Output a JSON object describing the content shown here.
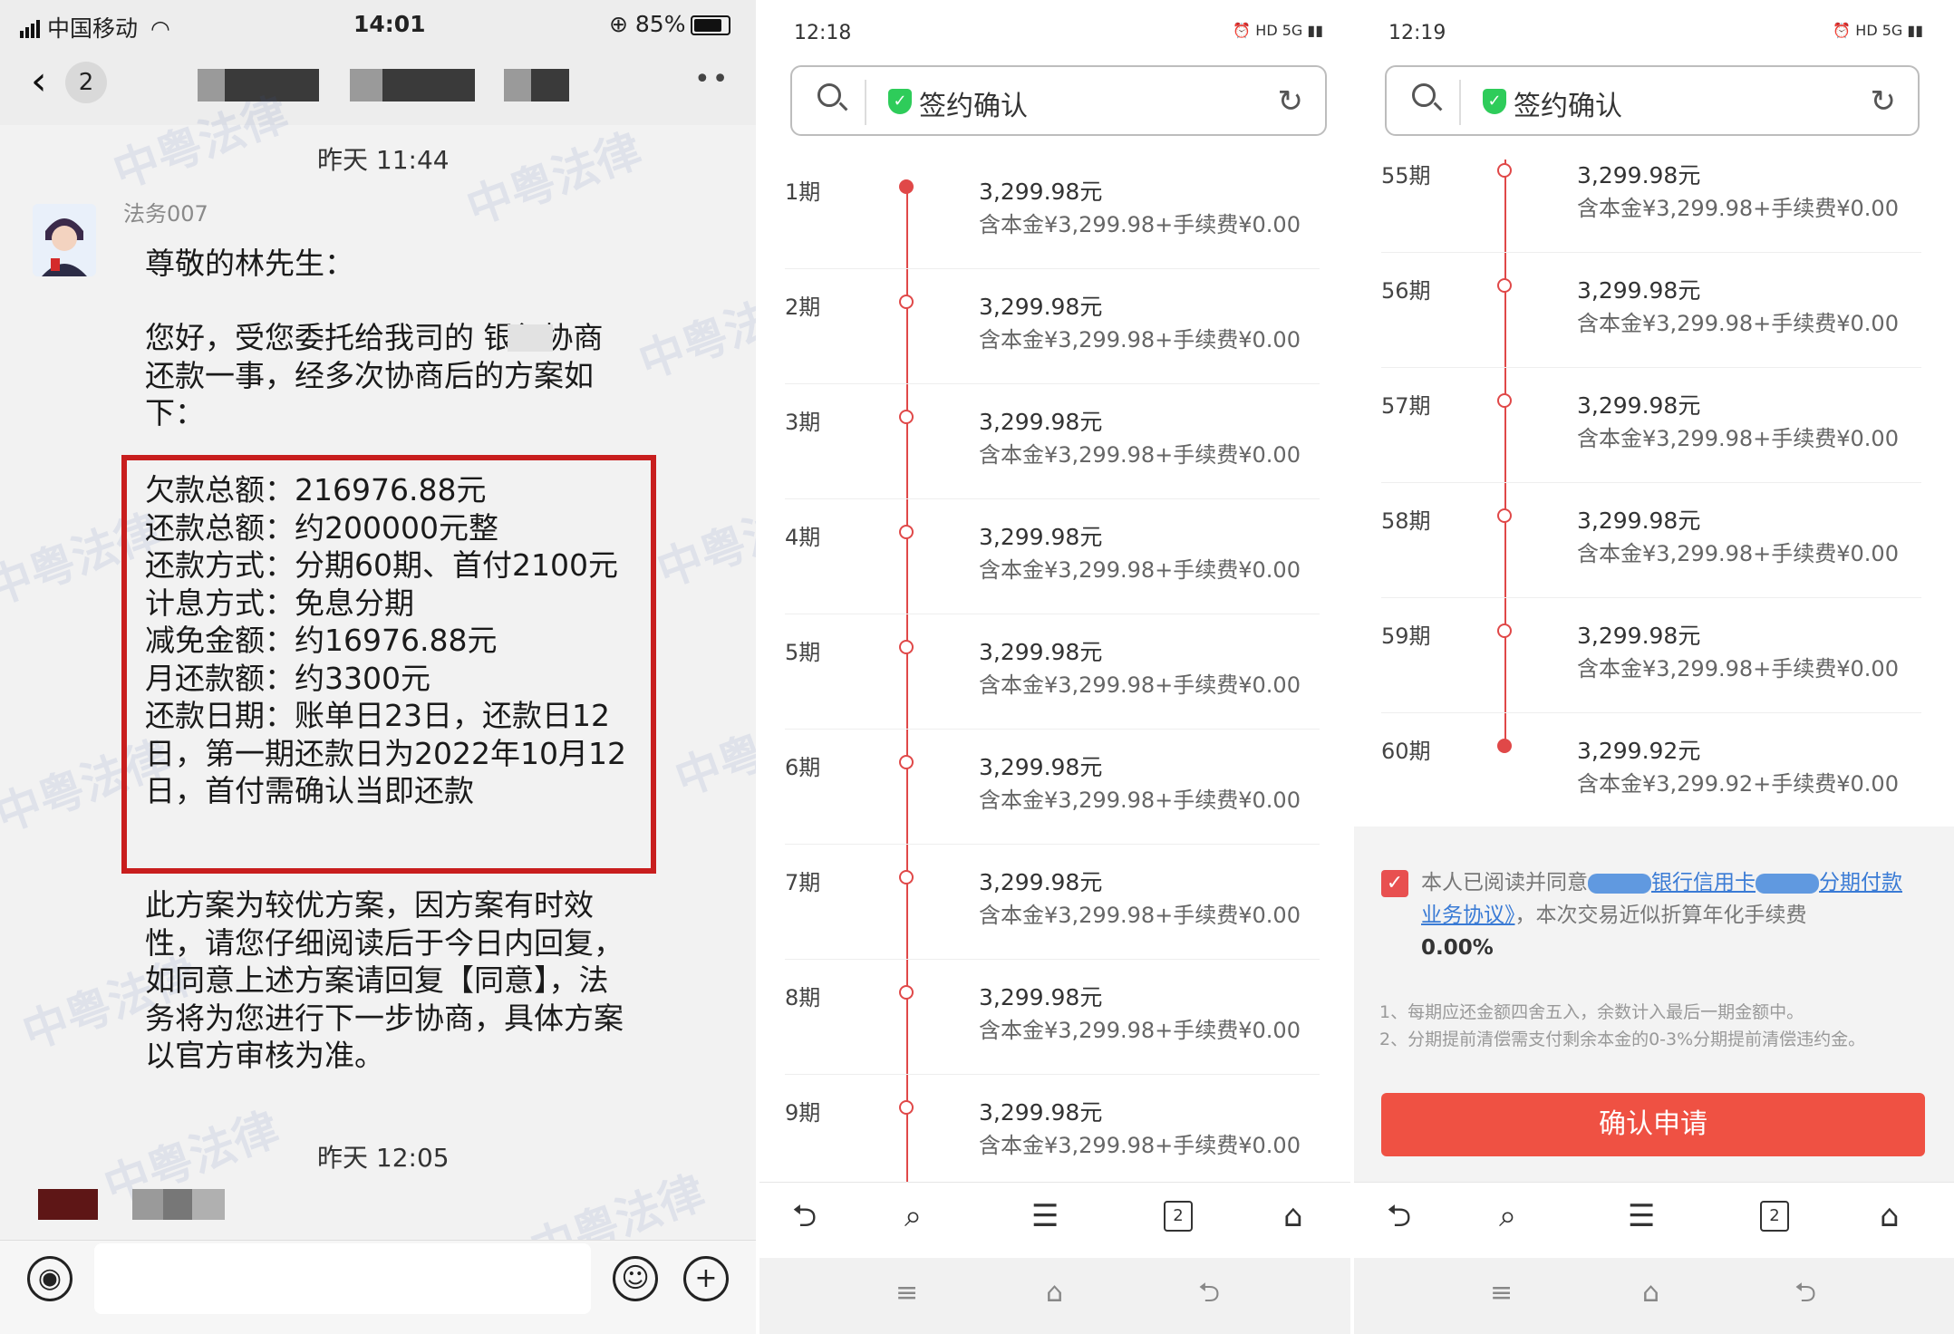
{
  "chat": {
    "carrier": "中国移动",
    "time": "14:01",
    "battery": "85%",
    "unread_count": "2",
    "timestamp1": "昨天 11:44",
    "sender": "法务007",
    "greeting": "尊敬的林先生：",
    "intro": "您好，受您委托给我司的    银行协商还款一事，经多次协商后的方案如下：",
    "plan_lines": [
      "欠款总额：216976.88元",
      "还款总额：约200000元整",
      "还款方式：分期60期、首付2100元",
      "计息方式：免息分期",
      "减免金额：约16976.88元",
      "月还款额：约3300元",
      "还款日期：账单日23日，还款日12日，第一期还款日为2022年10月12日，首付需确认当即还款"
    ],
    "closing": "此方案为较优方案，因方案有时效性，请您仔细阅读后于今日内回复，如同意上述方案请回复【同意】，法务将为您进行下一步协商，具体方案以官方审核为准。",
    "timestamp2": "昨天 12:05",
    "watermark": "中粤法律"
  },
  "screen2": {
    "time": "12:18",
    "title": "签约确认",
    "rows": [
      {
        "period": "1期",
        "amount": "3,299.98元",
        "detail": "含本金¥3,299.98+手续费¥0.00"
      },
      {
        "period": "2期",
        "amount": "3,299.98元",
        "detail": "含本金¥3,299.98+手续费¥0.00"
      },
      {
        "period": "3期",
        "amount": "3,299.98元",
        "detail": "含本金¥3,299.98+手续费¥0.00"
      },
      {
        "period": "4期",
        "amount": "3,299.98元",
        "detail": "含本金¥3,299.98+手续费¥0.00"
      },
      {
        "period": "5期",
        "amount": "3,299.98元",
        "detail": "含本金¥3,299.98+手续费¥0.00"
      },
      {
        "period": "6期",
        "amount": "3,299.98元",
        "detail": "含本金¥3,299.98+手续费¥0.00"
      },
      {
        "period": "7期",
        "amount": "3,299.98元",
        "detail": "含本金¥3,299.98+手续费¥0.00"
      },
      {
        "period": "8期",
        "amount": "3,299.98元",
        "detail": "含本金¥3,299.98+手续费¥0.00"
      },
      {
        "period": "9期",
        "amount": "3,299.98元",
        "detail": "含本金¥3,299.98+手续费¥0.00"
      }
    ],
    "tab_count": "2"
  },
  "screen3": {
    "time": "12:19",
    "title": "签约确认",
    "rows": [
      {
        "period": "55期",
        "amount": "3,299.98元",
        "detail": "含本金¥3,299.98+手续费¥0.00"
      },
      {
        "period": "56期",
        "amount": "3,299.98元",
        "detail": "含本金¥3,299.98+手续费¥0.00"
      },
      {
        "period": "57期",
        "amount": "3,299.98元",
        "detail": "含本金¥3,299.98+手续费¥0.00"
      },
      {
        "period": "58期",
        "amount": "3,299.98元",
        "detail": "含本金¥3,299.98+手续费¥0.00"
      },
      {
        "period": "59期",
        "amount": "3,299.98元",
        "detail": "含本金¥3,299.98+手续费¥0.00"
      },
      {
        "period": "60期",
        "amount": "3,299.92元",
        "detail": "含本金¥3,299.92+手续费¥0.00"
      }
    ],
    "agree_prefix": "本人已阅读并同意",
    "agree_link1": "银行信用卡",
    "agree_link2": "分期付款业务协议》",
    "agree_suffix": "，本次交易近似折算年化手续费",
    "agree_rate": "0.00%",
    "note1": "1、每期应还金额四舍五入，余数计入最后一期金额中。",
    "note2": "2、分期提前清偿需支付剩余本金的0-3%分期提前清偿违约金。",
    "confirm_label": "确认申请",
    "tab_count": "2"
  },
  "colors": {
    "accent_red": "#e04848",
    "button_red": "#ef5143",
    "box_red": "#c81e1e",
    "shield_green": "#2ecc5a",
    "link_blue": "#3a7bd5"
  }
}
